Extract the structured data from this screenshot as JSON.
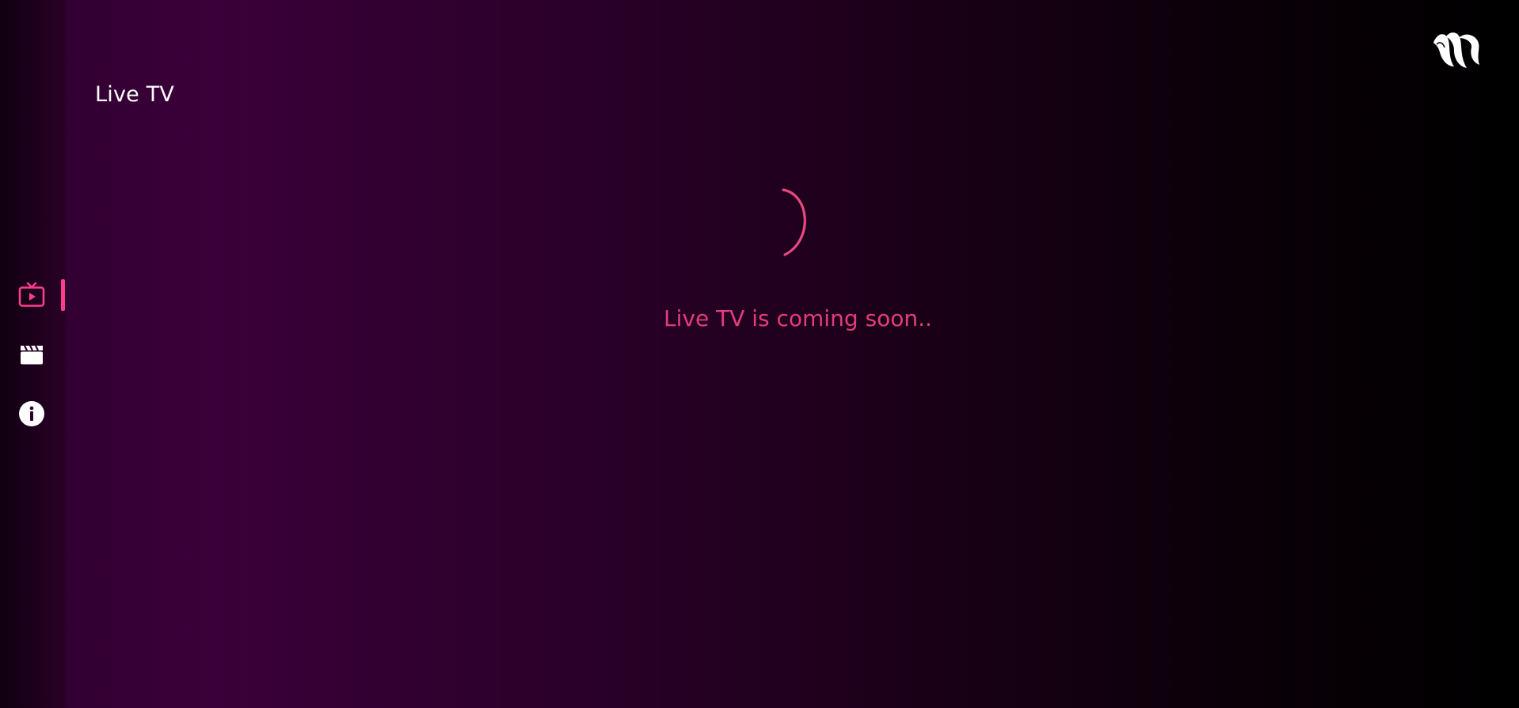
{
  "header": {
    "title": "Live TV"
  },
  "main": {
    "status_message": "Live TV is coming soon.."
  },
  "sidebar": {
    "items": [
      {
        "name": "live-tv",
        "icon": "tv-play-icon",
        "active": true
      },
      {
        "name": "movies",
        "icon": "clapperboard-icon",
        "active": false
      },
      {
        "name": "about",
        "icon": "info-icon",
        "active": false
      }
    ]
  },
  "logo": {
    "icon": "app-logo-wave-icon"
  },
  "colors": {
    "accent": "#ff3d8d",
    "status_text": "#e23d7a",
    "spinner": "#e8487f",
    "title_text": "#ffffff",
    "icon_inactive": "#ffffff"
  }
}
